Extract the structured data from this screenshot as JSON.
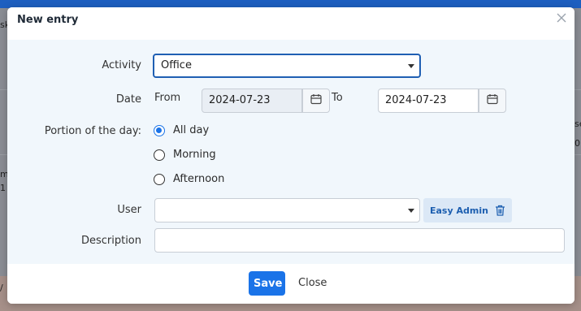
{
  "background": {
    "fragments": [
      "sk",
      "se",
      "0",
      "mi",
      "1 -",
      "/"
    ]
  },
  "modal": {
    "title": "New entry",
    "close_icon": "close-icon",
    "activity": {
      "label": "Activity",
      "value": "Office"
    },
    "date": {
      "label": "Date",
      "from_label": "From",
      "from_value": "2024-07-23",
      "to_label": "To",
      "to_value": "2024-07-23",
      "calendar_icon": "calendar-icon"
    },
    "portion": {
      "label": "Portion of the day:",
      "options": [
        "All day",
        "Morning",
        "Afternoon"
      ],
      "selected": "All day"
    },
    "user": {
      "label": "User",
      "value": "",
      "tag": "Easy Admin",
      "tag_icon": "trash-icon"
    },
    "description": {
      "label": "Description",
      "value": ""
    },
    "footer": {
      "save_label": "Save",
      "close_label": "Close"
    }
  },
  "colors": {
    "primary": "#1a73e8",
    "active_border": "#1f5fb3",
    "tag_bg": "#dbe8f6",
    "tag_text": "#1d5fb0",
    "body_bg": "#f1f7fc"
  }
}
